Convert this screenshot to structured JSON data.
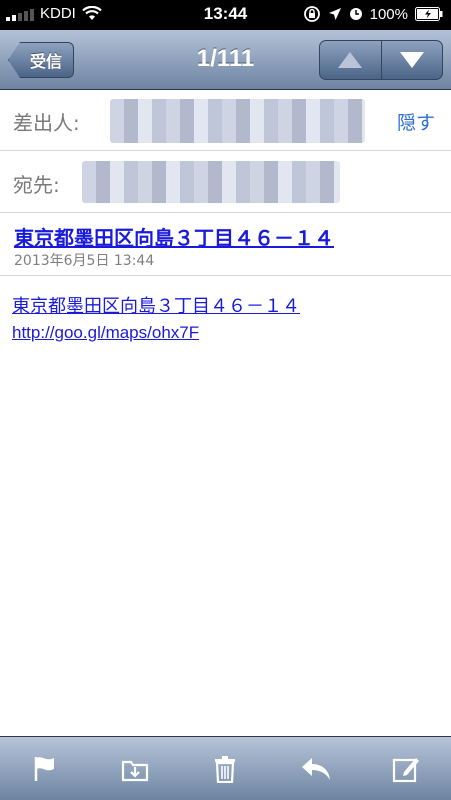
{
  "status_bar": {
    "carrier": "KDDI",
    "time": "13:44",
    "battery": "100%"
  },
  "nav": {
    "back_label": "受信",
    "title": "1/111"
  },
  "header": {
    "from_label": "差出人:",
    "hide_label": "隠す",
    "to_label": "宛先:"
  },
  "message": {
    "subject": "東京都墨田区向島３丁目４６－１４",
    "date": "2013年6月5日 13:44",
    "body_address": "東京都墨田区向島３丁目４６－１４",
    "body_link": "http://goo.gl/maps/ohx7F"
  },
  "colors": {
    "link": "#1a1adc",
    "accent": "#2f6fd0",
    "bar": "#6d84a2"
  },
  "icons": [
    "flag-icon",
    "move-folder-icon",
    "trash-icon",
    "reply-icon",
    "compose-icon"
  ]
}
